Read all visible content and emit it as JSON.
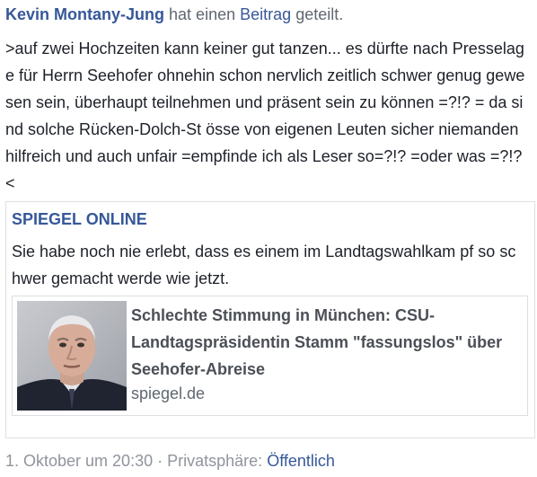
{
  "header": {
    "author": "Kevin Montany-Jung",
    "text_before_link": "hat einen",
    "link_label": "Beitrag",
    "text_after_link": "geteilt."
  },
  "post": {
    "text": ">auf zwei Hochzeiten kann keiner gut tanzen... es dürfte nach Presselage für Herrn Seehofer ohnehin schon nervlich zeitlich schwer genug gewesen sein, überhaupt teilnehmen und präsent sein zu können =?!? = da sind solche Rücken-Dolch-St össe von eigenen Leuten sicher niemanden hilfreich und auch unfair =empfinde ich als Leser so=?!? =oder was =?!?<"
  },
  "shared": {
    "source_name": "SPIEGEL ONLINE",
    "text": "Sie habe noch nie erlebt, dass es einem im Landtagswahlkam pf so schwer gemacht werde wie jetzt.",
    "link_preview": {
      "title": "Schlechte Stimmung in München: CSU-Landtagspräsidentin Stamm \"fassungslos\" über Seehofer-Abreise",
      "domain": "spiegel.de"
    }
  },
  "footer": {
    "timestamp": "1. Oktober um 20:30",
    "separator": "·",
    "privacy_label": "Privatsphäre:",
    "privacy_value": "Öffentlich"
  },
  "colors": {
    "link_blue": "#365899",
    "text_dark": "#1d2129",
    "text_muted": "#606770",
    "border": "#dddfe2"
  }
}
